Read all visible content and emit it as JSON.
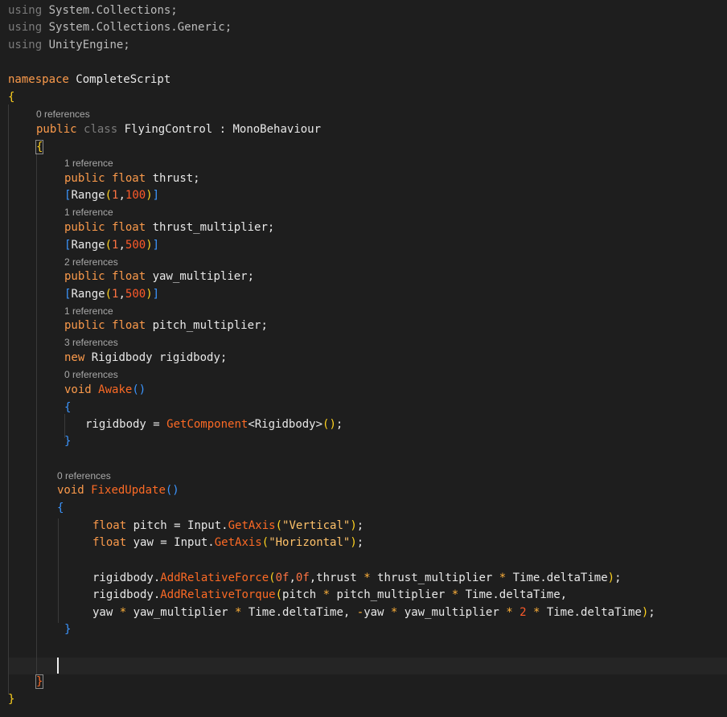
{
  "editor": {
    "colors": {
      "background": "#1e1e1e",
      "text": "#e8e8e8",
      "keyword": "#fb9a4b",
      "function": "#fc6a25",
      "number": "#ff7443",
      "string": "#ffc26a",
      "brace": "#ffd21e",
      "bracket": "#3c96ff",
      "comment_lens": "#a8a8a8"
    },
    "lines": [
      {
        "tokens": [
          {
            "t": "using",
            "c": 1
          },
          {
            "t": " System.Collections;",
            "c": 2
          }
        ]
      },
      {
        "tokens": [
          {
            "t": "using",
            "c": 1
          },
          {
            "t": " System.Collections.Generic;",
            "c": 2
          }
        ]
      },
      {
        "tokens": [
          {
            "t": "using",
            "c": 1
          },
          {
            "t": " UnityEngine;",
            "c": 2
          }
        ]
      },
      {
        "tokens": [
          {
            "t": "namespace",
            "c": 3
          },
          {
            "t": " CompleteScript",
            "c": 0
          }
        ]
      },
      {
        "tokens": [
          {
            "t": "{",
            "c": 4
          }
        ]
      },
      {
        "tokens": [
          {
            "t": "public",
            "c": 3
          },
          {
            "t": " ",
            "c": 0
          },
          {
            "t": "class",
            "c": 1
          },
          {
            "t": " FlyingControl : MonoBehaviour",
            "c": 0
          }
        ]
      },
      {
        "tokens": [
          {
            "t": "{",
            "c": 4,
            "box": true
          }
        ]
      },
      {
        "tokens": [
          {
            "t": "public",
            "c": 3
          },
          {
            "t": " ",
            "c": 0
          },
          {
            "t": "float",
            "c": 3
          },
          {
            "t": " thrust;",
            "c": 0
          }
        ]
      },
      {
        "tokens": [
          {
            "t": "[",
            "c": 6
          },
          {
            "t": "Range",
            "c": 0
          },
          {
            "t": "(",
            "c": 4
          },
          {
            "t": "1",
            "c": 7
          },
          {
            "t": ",",
            "c": 0
          },
          {
            "t": "100",
            "c": 11
          },
          {
            "t": ")",
            "c": 4
          },
          {
            "t": "]",
            "c": 6
          }
        ]
      },
      {
        "tokens": [
          {
            "t": "public",
            "c": 3
          },
          {
            "t": " ",
            "c": 0
          },
          {
            "t": "float",
            "c": 3
          },
          {
            "t": " thrust_multiplier;",
            "c": 0
          }
        ]
      },
      {
        "tokens": [
          {
            "t": "[",
            "c": 6
          },
          {
            "t": "Range",
            "c": 0
          },
          {
            "t": "(",
            "c": 4
          },
          {
            "t": "1",
            "c": 7
          },
          {
            "t": ",",
            "c": 0
          },
          {
            "t": "500",
            "c": 11
          },
          {
            "t": ")",
            "c": 4
          },
          {
            "t": "]",
            "c": 6
          }
        ]
      },
      {
        "tokens": [
          {
            "t": "public",
            "c": 3
          },
          {
            "t": " ",
            "c": 0
          },
          {
            "t": "float",
            "c": 3
          },
          {
            "t": " yaw_multiplier;",
            "c": 0
          }
        ]
      },
      {
        "tokens": [
          {
            "t": "[",
            "c": 6
          },
          {
            "t": "Range",
            "c": 0
          },
          {
            "t": "(",
            "c": 4
          },
          {
            "t": "1",
            "c": 7
          },
          {
            "t": ",",
            "c": 0
          },
          {
            "t": "500",
            "c": 11
          },
          {
            "t": ")",
            "c": 4
          },
          {
            "t": "]",
            "c": 6
          }
        ]
      },
      {
        "tokens": [
          {
            "t": "public",
            "c": 3
          },
          {
            "t": " ",
            "c": 0
          },
          {
            "t": "float",
            "c": 3
          },
          {
            "t": " pitch_multiplier;",
            "c": 0
          }
        ]
      },
      {
        "tokens": [
          {
            "t": "new",
            "c": 3
          },
          {
            "t": " Rigidbody rigidbody;",
            "c": 0
          }
        ]
      },
      {
        "tokens": [
          {
            "t": "void",
            "c": 3
          },
          {
            "t": " ",
            "c": 0
          },
          {
            "t": "Awake",
            "c": 5
          },
          {
            "t": "()",
            "c": 6
          }
        ]
      },
      {
        "tokens": [
          {
            "t": "{",
            "c": 6
          }
        ]
      },
      {
        "tokens": [
          {
            "t": "rigidbody = ",
            "c": 0
          },
          {
            "t": "GetComponent",
            "c": 5
          },
          {
            "t": "<Rigidbody>",
            "c": 0
          },
          {
            "t": "()",
            "c": 4
          },
          {
            "t": ";",
            "c": 0
          }
        ]
      },
      {
        "tokens": [
          {
            "t": "}",
            "c": 6
          }
        ]
      },
      {
        "tokens": [
          {
            "t": "void",
            "c": 3
          },
          {
            "t": " ",
            "c": 0
          },
          {
            "t": "FixedUpdate",
            "c": 5
          },
          {
            "t": "()",
            "c": 6
          }
        ]
      },
      {
        "tokens": [
          {
            "t": "{",
            "c": 6
          }
        ]
      },
      {
        "tokens": [
          {
            "t": "float",
            "c": 3
          },
          {
            "t": " pitch = Input.",
            "c": 0
          },
          {
            "t": "GetAxis",
            "c": 5
          },
          {
            "t": "(",
            "c": 4
          },
          {
            "t": "\"Vertical\"",
            "c": 8
          },
          {
            "t": ")",
            "c": 4
          },
          {
            "t": ";",
            "c": 0
          }
        ]
      },
      {
        "tokens": [
          {
            "t": "float",
            "c": 3
          },
          {
            "t": " yaw = Input.",
            "c": 0
          },
          {
            "t": "GetAxis",
            "c": 5
          },
          {
            "t": "(",
            "c": 4
          },
          {
            "t": "\"Horizontal\"",
            "c": 8
          },
          {
            "t": ")",
            "c": 4
          },
          {
            "t": ";",
            "c": 0
          }
        ]
      },
      {
        "tokens": [
          {
            "t": "rigidbody.",
            "c": 0
          },
          {
            "t": "AddRelativeForce",
            "c": 5
          },
          {
            "t": "(",
            "c": 4
          },
          {
            "t": "0f",
            "c": 7
          },
          {
            "t": ",",
            "c": 0
          },
          {
            "t": "0f",
            "c": 7
          },
          {
            "t": ",thrust ",
            "c": 0
          },
          {
            "t": "*",
            "c": 9
          },
          {
            "t": " thrust_multiplier ",
            "c": 0
          },
          {
            "t": "*",
            "c": 9
          },
          {
            "t": " Time.deltaTime",
            "c": 0
          },
          {
            "t": ")",
            "c": 4
          },
          {
            "t": ";",
            "c": 0
          }
        ]
      },
      {
        "tokens": [
          {
            "t": "rigidbody.",
            "c": 0
          },
          {
            "t": "AddRelativeTorque",
            "c": 5
          },
          {
            "t": "(",
            "c": 4
          },
          {
            "t": "pitch ",
            "c": 0
          },
          {
            "t": "*",
            "c": 9
          },
          {
            "t": " pitch_multiplier ",
            "c": 0
          },
          {
            "t": "*",
            "c": 9
          },
          {
            "t": " Time.deltaTime,",
            "c": 0
          }
        ]
      },
      {
        "tokens": [
          {
            "t": "yaw ",
            "c": 0
          },
          {
            "t": "*",
            "c": 9
          },
          {
            "t": " yaw_multiplier ",
            "c": 0
          },
          {
            "t": "*",
            "c": 9
          },
          {
            "t": " Time.deltaTime, ",
            "c": 0
          },
          {
            "t": "-",
            "c": 9
          },
          {
            "t": "yaw ",
            "c": 0
          },
          {
            "t": "*",
            "c": 9
          },
          {
            "t": " yaw_multiplier ",
            "c": 0
          },
          {
            "t": "*",
            "c": 9
          },
          {
            "t": " ",
            "c": 0
          },
          {
            "t": "2",
            "c": 11
          },
          {
            "t": " ",
            "c": 0
          },
          {
            "t": "*",
            "c": 9
          },
          {
            "t": " Time.deltaTime",
            "c": 0
          },
          {
            "t": ")",
            "c": 4
          },
          {
            "t": ";",
            "c": 0
          }
        ]
      },
      {
        "tokens": [
          {
            "t": "}",
            "c": 6
          }
        ]
      },
      {
        "tokens": []
      },
      {
        "tokens": [
          {
            "t": "}",
            "c": 5,
            "box": true
          }
        ]
      },
      {
        "tokens": [
          {
            "t": "}",
            "c": 4
          }
        ]
      }
    ],
    "code_lens": [
      "0 references",
      "1 reference",
      "1 reference",
      "2 references",
      "1 reference",
      "3 references",
      "0 references",
      "0 references"
    ]
  }
}
